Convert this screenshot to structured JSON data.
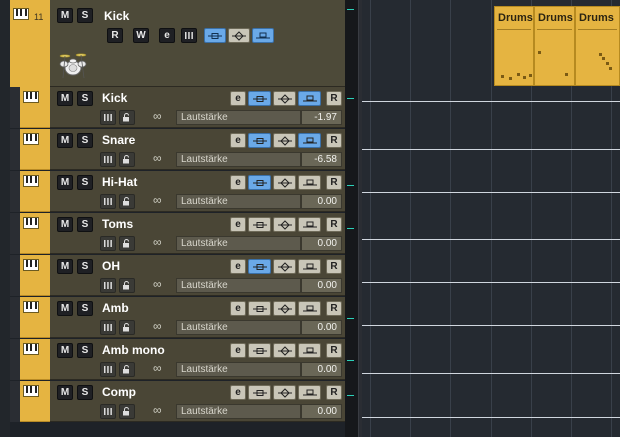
{
  "parent_track": {
    "number": "11",
    "name": "Kick",
    "mute_label": "M",
    "solo_label": "S",
    "read_label": "R",
    "write_label": "W",
    "edit_label": "e"
  },
  "child_tracks": [
    {
      "name": "Kick",
      "param": "Lautstärke",
      "value": "-1.97",
      "mode_active": true,
      "read_active": true,
      "read_label": "R",
      "edit_label": "e",
      "mute_label": "M",
      "solo_label": "S"
    },
    {
      "name": "Snare",
      "param": "Lautstärke",
      "value": "-6.58",
      "mode_active": true,
      "read_active": true,
      "read_label": "R",
      "edit_label": "e",
      "mute_label": "M",
      "solo_label": "S"
    },
    {
      "name": "Hi-Hat",
      "param": "Lautstärke",
      "value": "0.00",
      "mode_active": true,
      "read_active": false,
      "read_label": "R",
      "edit_label": "e",
      "mute_label": "M",
      "solo_label": "S"
    },
    {
      "name": "Toms",
      "param": "Lautstärke",
      "value": "0.00",
      "mode_active": false,
      "read_active": false,
      "read_label": "R",
      "edit_label": "e",
      "mute_label": "M",
      "solo_label": "S"
    },
    {
      "name": "OH",
      "param": "Lautstärke",
      "value": "0.00",
      "mode_active": true,
      "read_active": false,
      "read_label": "R",
      "edit_label": "e",
      "mute_label": "M",
      "solo_label": "S"
    },
    {
      "name": "Amb",
      "param": "Lautstärke",
      "value": "0.00",
      "mode_active": false,
      "read_active": false,
      "read_label": "R",
      "edit_label": "e",
      "mute_label": "M",
      "solo_label": "S"
    },
    {
      "name": "Amb mono",
      "param": "Lautstärke",
      "value": "0.00",
      "mode_active": false,
      "read_active": false,
      "read_label": "R",
      "edit_label": "e",
      "mute_label": "M",
      "solo_label": "S"
    },
    {
      "name": "Comp",
      "param": "Lautstärke",
      "value": "0.00",
      "mode_active": false,
      "read_active": false,
      "read_label": "R",
      "edit_label": "e",
      "mute_label": "M",
      "solo_label": "S"
    }
  ],
  "events": [
    {
      "label": "Drums"
    },
    {
      "label": "Drums"
    },
    {
      "label": "Drums"
    }
  ],
  "colors": {
    "track_color": "#e5b441",
    "active_button": "#6aa9e8",
    "track_bg": "#4a4636",
    "arrange_bg": "#252a31"
  },
  "icons": [
    "piano-keys-icon",
    "drum-kit-icon",
    "link-icon",
    "lock-icon",
    "channel-settings-icon",
    "automation-mode-icon",
    "diamond-icon"
  ]
}
